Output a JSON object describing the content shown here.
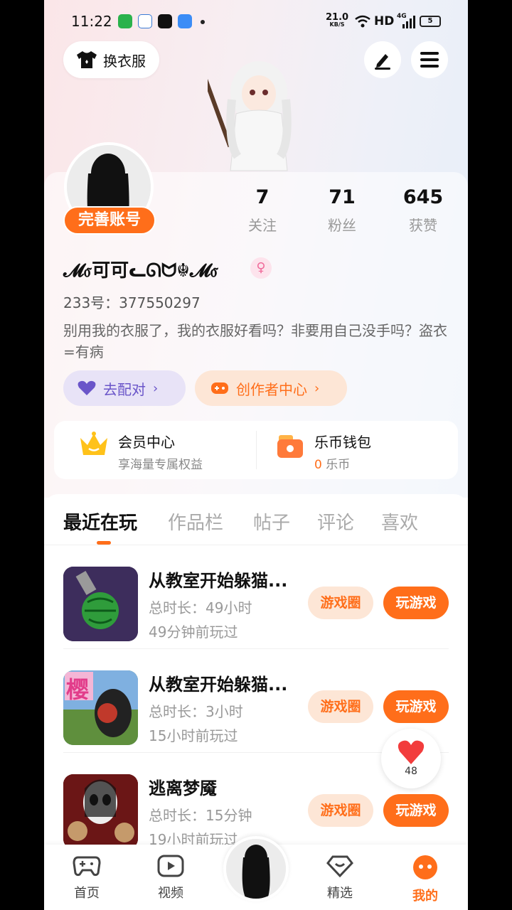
{
  "status_bar": {
    "time": "11:22",
    "net_speed_value": "21.0",
    "net_speed_unit": "KB/S",
    "hd": "HD",
    "signal": "4G",
    "battery": "5"
  },
  "header": {
    "outfit_label": "换衣服"
  },
  "profile": {
    "complete_account_label": "完善账号",
    "stats": [
      {
        "value": "7",
        "label": "关注"
      },
      {
        "value": "71",
        "label": "粉丝"
      },
      {
        "value": "645",
        "label": "获赞"
      }
    ],
    "nickname": "𝓜ⳝ可可ᓚᘏᗢ☬𝓜ⳝ",
    "gender_symbol": "♀",
    "id_line": "233号：377550297",
    "bio": "别用我的衣服了，我的衣服好看吗？非要用自己没手吗？盗衣=有病",
    "match_label": "去配对",
    "creator_label": "创作者中心"
  },
  "member_card": {
    "vip_title": "会员中心",
    "vip_sub": "享海量专属权益",
    "wallet_title": "乐币钱包",
    "wallet_amount": "0",
    "wallet_unit": "乐币"
  },
  "tabs": [
    "最近在玩",
    "作品栏",
    "帖子",
    "评论",
    "喜欢"
  ],
  "games": [
    {
      "title": "从教室开始躲猫...",
      "duration": "总时长：49小时",
      "last_played": "49分钟前玩过",
      "circle_label": "游戏圈",
      "play_label": "玩游戏"
    },
    {
      "title": "从教室开始躲猫...",
      "duration": "总时长：3小时",
      "last_played": "15小时前玩过",
      "circle_label": "游戏圈",
      "play_label": "玩游戏",
      "thumb_text": "樱"
    },
    {
      "title": "逃离梦魇",
      "duration": "总时长：15分钟",
      "last_played": "19小时前玩过",
      "circle_label": "游戏圈",
      "play_label": "玩游戏"
    }
  ],
  "like_bubble": {
    "count": "48"
  },
  "bottom_nav": [
    {
      "label": "首页",
      "icon": "gamepad-icon"
    },
    {
      "label": "视频",
      "icon": "video-icon"
    },
    {
      "label": "精选",
      "icon": "heart-diamond-icon"
    },
    {
      "label": "我的",
      "icon": "face-icon",
      "active": true
    }
  ],
  "colors": {
    "accent": "#ff6e1a",
    "match_purple": "#6a55c9"
  }
}
